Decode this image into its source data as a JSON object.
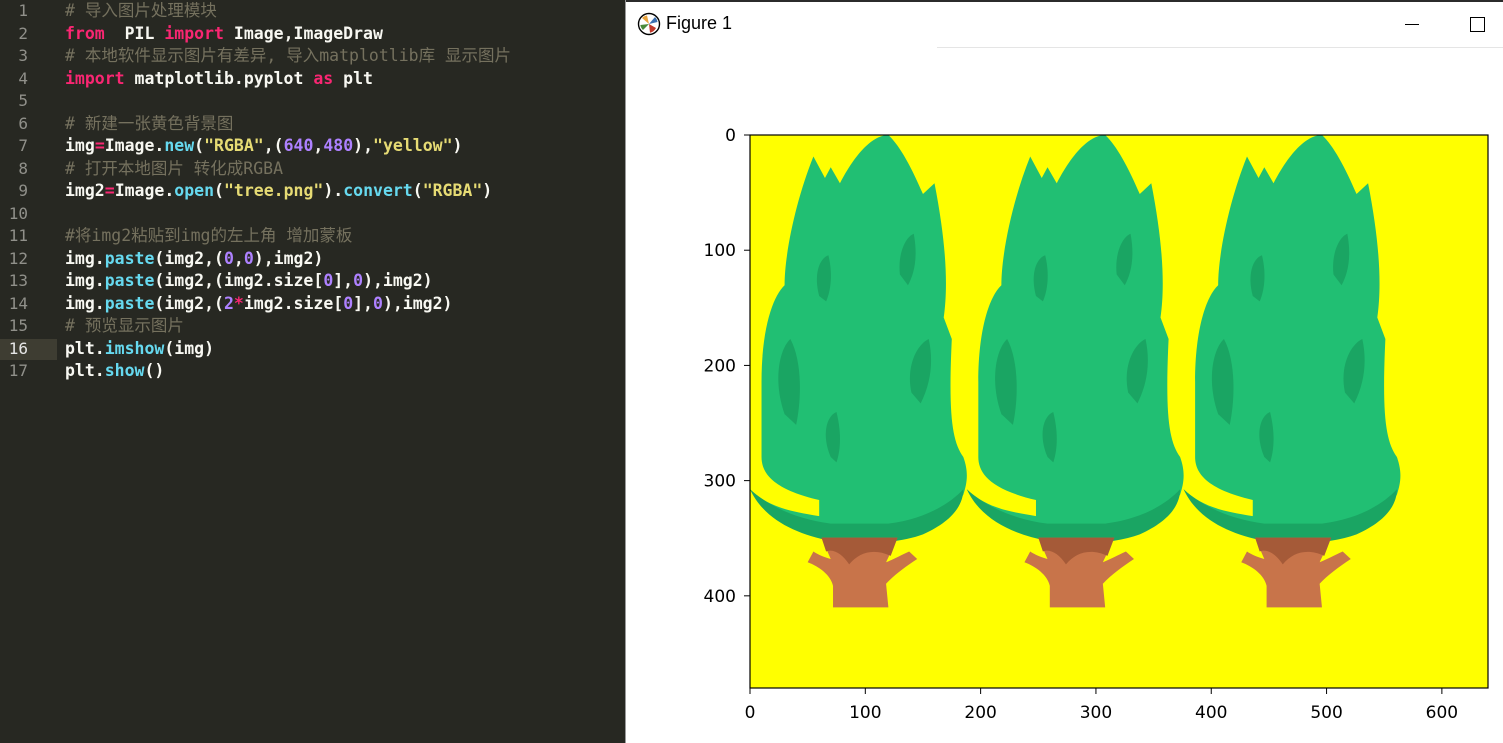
{
  "editor": {
    "active_line": 16,
    "lines": [
      {
        "n": "1",
        "tokens": [
          [
            "cm",
            "# 导入图片处理模块"
          ]
        ]
      },
      {
        "n": "2",
        "tokens": [
          [
            "kw",
            "from"
          ],
          [
            "",
            "  PIL "
          ],
          [
            "kw",
            "import"
          ],
          [
            "",
            " Image,ImageDraw"
          ]
        ]
      },
      {
        "n": "3",
        "tokens": [
          [
            "cm",
            "# 本地软件显示图片有差异, 导入matplotlib库 显示图片"
          ]
        ]
      },
      {
        "n": "4",
        "tokens": [
          [
            "kw",
            "import"
          ],
          [
            "",
            " matplotlib.pyplot "
          ],
          [
            "kw",
            "as"
          ],
          [
            "",
            " plt"
          ]
        ]
      },
      {
        "n": "5",
        "tokens": []
      },
      {
        "n": "6",
        "tokens": [
          [
            "cm",
            "# 新建一张黄色背景图"
          ]
        ]
      },
      {
        "n": "7",
        "tokens": [
          [
            "",
            "img"
          ],
          [
            "op",
            "="
          ],
          [
            "",
            "Image."
          ],
          [
            "fn",
            "new"
          ],
          [
            "",
            "("
          ],
          [
            "str",
            "\"RGBA\""
          ],
          [
            "",
            ",("
          ],
          [
            "num",
            "640"
          ],
          [
            "",
            ","
          ],
          [
            "num",
            "480"
          ],
          [
            "",
            "),"
          ],
          [
            "str",
            "\"yellow\""
          ],
          [
            "",
            ")"
          ]
        ]
      },
      {
        "n": "8",
        "tokens": [
          [
            "cm",
            "# 打开本地图片 转化成RGBA"
          ]
        ]
      },
      {
        "n": "9",
        "tokens": [
          [
            "",
            "img2"
          ],
          [
            "op",
            "="
          ],
          [
            "",
            "Image."
          ],
          [
            "fn",
            "open"
          ],
          [
            "",
            "("
          ],
          [
            "str",
            "\"tree.png\""
          ],
          [
            "",
            ")."
          ],
          [
            "fn",
            "convert"
          ],
          [
            "",
            "("
          ],
          [
            "str",
            "\"RGBA\""
          ],
          [
            "",
            ")"
          ]
        ]
      },
      {
        "n": "10",
        "tokens": []
      },
      {
        "n": "11",
        "tokens": [
          [
            "cm",
            "#将img2粘贴到img的左上角 增加蒙板"
          ]
        ]
      },
      {
        "n": "12",
        "tokens": [
          [
            "",
            "img."
          ],
          [
            "fn",
            "paste"
          ],
          [
            "",
            "(img2,("
          ],
          [
            "num",
            "0"
          ],
          [
            "",
            ","
          ],
          [
            "num",
            "0"
          ],
          [
            "",
            "),img2)"
          ]
        ]
      },
      {
        "n": "13",
        "tokens": [
          [
            "",
            "img."
          ],
          [
            "fn",
            "paste"
          ],
          [
            "",
            "(img2,(img2.size["
          ],
          [
            "num",
            "0"
          ],
          [
            "",
            "],"
          ],
          [
            "num",
            "0"
          ],
          [
            "",
            "),img2)"
          ]
        ]
      },
      {
        "n": "14",
        "tokens": [
          [
            "",
            "img."
          ],
          [
            "fn",
            "paste"
          ],
          [
            "",
            "(img2,("
          ],
          [
            "num",
            "2"
          ],
          [
            "op",
            "*"
          ],
          [
            "",
            "img2.size["
          ],
          [
            "num",
            "0"
          ],
          [
            "",
            "],"
          ],
          [
            "num",
            "0"
          ],
          [
            "",
            "),img2)"
          ]
        ]
      },
      {
        "n": "15",
        "tokens": [
          [
            "cm",
            "# 预览显示图片"
          ]
        ]
      },
      {
        "n": "16",
        "tokens": [
          [
            "",
            "plt."
          ],
          [
            "fn",
            "imshow"
          ],
          [
            "",
            "(img)"
          ]
        ]
      },
      {
        "n": "17",
        "tokens": [
          [
            "",
            "plt."
          ],
          [
            "fn",
            "show"
          ],
          [
            "",
            "()"
          ]
        ]
      }
    ]
  },
  "figure_window": {
    "title": "Figure 1",
    "icon": "matplotlib-logo-icon",
    "minimize_icon": "minimize-icon",
    "maximize_icon": "maximize-icon"
  },
  "chart_data": {
    "type": "image",
    "title": "",
    "xlabel": "",
    "ylabel": "",
    "xlim": [
      0,
      640
    ],
    "ylim": [
      480,
      0
    ],
    "x_ticks": [
      0,
      100,
      200,
      300,
      400,
      500,
      600
    ],
    "y_ticks": [
      0,
      100,
      200,
      300,
      400
    ],
    "background_color": "#ffff00",
    "tree_colors": {
      "foliage": "#21bf73",
      "foliage_dark": "#1aa563",
      "trunk": "#c8744a",
      "trunk_dark": "#a55a38"
    },
    "tree_offsets_x": [
      0,
      188,
      376
    ],
    "tree_width": 188,
    "tree_height": 410
  }
}
